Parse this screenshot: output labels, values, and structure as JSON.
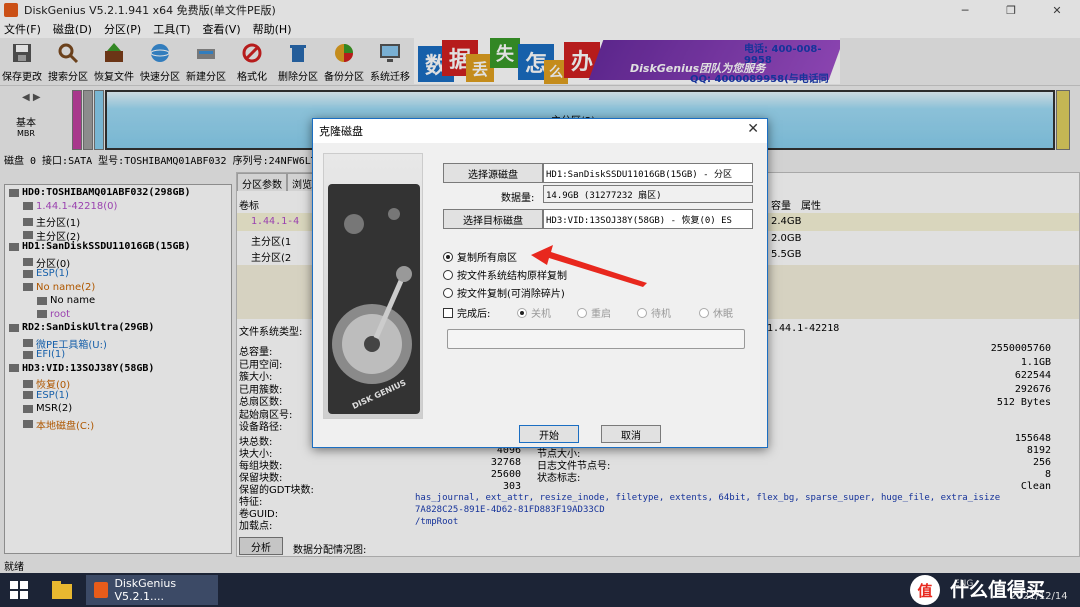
{
  "window": {
    "title": "DiskGenius V5.2.1.941 x64 免费版(单文件PE版)"
  },
  "menu": [
    "文件(F)",
    "磁盘(D)",
    "分区(P)",
    "工具(T)",
    "查看(V)",
    "帮助(H)"
  ],
  "toolbar": [
    {
      "label": "保存更改",
      "icon": "save-icon"
    },
    {
      "label": "搜索分区",
      "icon": "magnifier-icon"
    },
    {
      "label": "恢复文件",
      "icon": "recover-icon"
    },
    {
      "label": "快速分区",
      "icon": "globe-icon"
    },
    {
      "label": "新建分区",
      "icon": "new-partition-icon"
    },
    {
      "label": "格式化",
      "icon": "format-icon"
    },
    {
      "label": "删除分区",
      "icon": "trash-icon"
    },
    {
      "label": "备份分区",
      "icon": "pie-icon"
    },
    {
      "label": "系统迁移",
      "icon": "monitor-icon"
    }
  ],
  "banner": {
    "chars": [
      "数",
      "据",
      "丢",
      "失",
      "怎",
      "么",
      "办"
    ],
    "slogan": "DiskGenius团队为您服务",
    "phone": "电话: 400-008-9958",
    "qq": "QQ: 4000089958(与电话同号)"
  },
  "diskmap": {
    "type": "基本",
    "style": "MBR",
    "main_label": "主分区(2)"
  },
  "diskinfo": {
    "text": "磁盘 0 接口:SATA  型号:TOSHIBAMQ01ABF032  序列号:24NFW6LTT"
  },
  "tree": [
    {
      "label": "HD0:TOSHIBAMQ01ABF032(298GB)",
      "level": 0,
      "color": "#000000",
      "bold": true
    },
    {
      "label": "1.44.1-42218(0)",
      "level": 1,
      "color": "#b04cc8",
      "bold": false
    },
    {
      "label": "主分区(1)",
      "level": 1,
      "color": "#000000",
      "bold": false
    },
    {
      "label": "主分区(2)",
      "level": 1,
      "color": "#000000",
      "bold": false
    },
    {
      "label": "HD1:SanDiskSSDU11016GB(15GB)",
      "level": 0,
      "color": "#000000",
      "bold": true
    },
    {
      "label": "分区(0)",
      "level": 1,
      "color": "#000000",
      "bold": false
    },
    {
      "label": "ESP(1)",
      "level": 1,
      "color": "#1b6ec2",
      "bold": false
    },
    {
      "label": "No name(2)",
      "level": 1,
      "color": "#c86400",
      "bold": false
    },
    {
      "label": "No name",
      "level": 2,
      "color": "#000000",
      "bold": false
    },
    {
      "label": "root",
      "level": 2,
      "color": "#b04cc8",
      "bold": false
    },
    {
      "label": "RD2:SanDiskUltra(29GB)",
      "level": 0,
      "color": "#000000",
      "bold": true
    },
    {
      "label": "微PE工具箱(U:)",
      "level": 1,
      "color": "#1b6ec2",
      "bold": false
    },
    {
      "label": "EFI(1)",
      "level": 1,
      "color": "#1b6ec2",
      "bold": false
    },
    {
      "label": "HD3:VID:13SOJ38Y(58GB)",
      "level": 0,
      "color": "#000000",
      "bold": true
    },
    {
      "label": "恢复(0)",
      "level": 1,
      "color": "#c86400",
      "bold": false
    },
    {
      "label": "ESP(1)",
      "level": 1,
      "color": "#1b6ec2",
      "bold": false
    },
    {
      "label": "MSR(2)",
      "level": 1,
      "color": "#000000",
      "bold": false
    },
    {
      "label": "本地磁盘(C:)",
      "level": 1,
      "color": "#c86400",
      "bold": false
    }
  ],
  "right": {
    "tabs": [
      "分区参数",
      "浏览"
    ],
    "col_volume": "卷标",
    "col_capacity": "容量",
    "col_attr": "属性",
    "rows": [
      {
        "name": "1.44.1-4",
        "cap": "2.4GB"
      },
      {
        "name": "主分区(1",
        "cap": "2.0GB"
      },
      {
        "name": "主分区(2",
        "cap": "5.5GB"
      }
    ],
    "fs_label": "文件系统类型:",
    "fs_value": "1.44.1-42218",
    "left_labels": [
      "总容量:",
      "已用空间:",
      "簇大小:",
      "已用簇数:",
      "总扇区数:",
      "起始扇区号:",
      "设备路径:"
    ],
    "right_values": [
      "2550005760",
      "1.1GB",
      "622544",
      "292676",
      "512 Bytes"
    ],
    "block_labels": [
      "块总数:",
      "块大小:",
      "每组块数:",
      "保留块数:",
      "保留的GDT块数:",
      "特征:",
      "卷GUID:",
      "加载点:"
    ],
    "block_mid": [
      "4096",
      "32768",
      "25600",
      "303"
    ],
    "block_mid2": [
      "节点大小:",
      "日志文件节点号:",
      "状态标志:"
    ],
    "block_right": [
      "155648",
      "8192",
      "256",
      "8",
      "Clean"
    ],
    "features": "has_journal, ext_attr, resize_inode, filetype, extents, 64bit, flex_bg, sparse_super, huge_file, extra_isize",
    "guid": "7A828C25-891E-4D62-81FD883F19AD33CD",
    "mount": "/tmpRoot",
    "analyze_btn": "分析",
    "dist_label": "数据分配情况图:"
  },
  "status": "就绪",
  "taskbar": {
    "app": "DiskGenius V5.2.1....",
    "clock": "2021/12/14",
    "brand": "什么值得买",
    "lang": "ENG"
  },
  "dialog": {
    "title": "克隆磁盘",
    "select_source": "选择源磁盘",
    "source_value": "HD1:SanDiskSSDU11016GB(15GB) - 分区",
    "data_label": "数据量:",
    "data_value": "14.9GB (31277232 扇区)",
    "select_target": "选择目标磁盘",
    "target_value": "HD3:VID:13SOJ38Y(58GB) - 恢复(0) ES",
    "opt1": "复制所有扇区",
    "opt2": "按文件系统结构原样复制",
    "opt3": "按文件复制(可消除碎片)",
    "done_label": "完成后:",
    "after_opts": [
      "关机",
      "重启",
      "待机",
      "休眠"
    ],
    "start": "开始",
    "cancel": "取消",
    "hdd_brand": "DISK GENIUS"
  }
}
